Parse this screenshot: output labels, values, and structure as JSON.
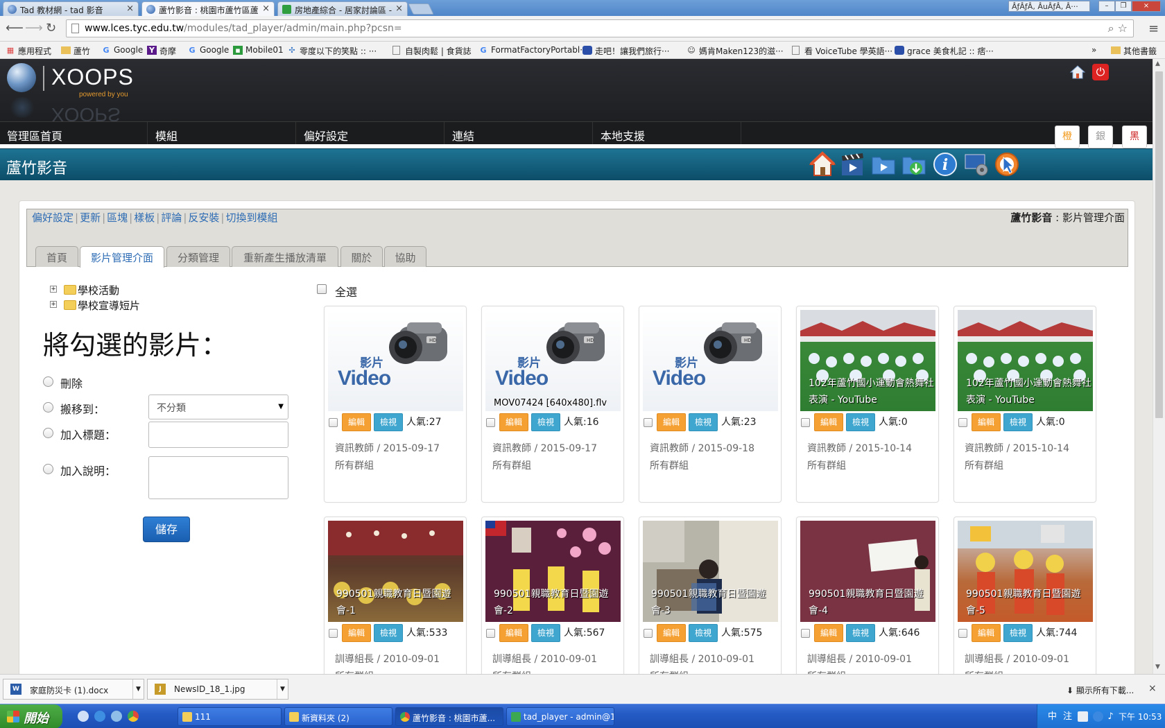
{
  "browser": {
    "tabs": [
      {
        "title": "Tad 教材網 - tad 影音"
      },
      {
        "title": "蘆竹影音 : 桃園市蘆竹區蘆"
      },
      {
        "title": "房地產綜合 - 居家討論區 -"
      }
    ],
    "tab_close": "×",
    "window_user": "ÂƒÂƒÂ, ÂuÂƒÂ, Â···",
    "window_buttons": {
      "minimize": "–",
      "restore": "❐",
      "close": "×"
    },
    "url_host": "www.lces.tyc.edu.tw",
    "url_path": "/modules/tad_player/admin/main.php?pcsn=",
    "bookmarks": [
      "應用程式",
      "蘆竹",
      "Google",
      "奇摩",
      "Google",
      "Mobile01",
      "零度以下的笑點 :: ···",
      "自製肉鬆 | 食貨誌",
      "FormatFactoryPortabl···",
      "走吧！讓我們旅行···",
      "媽肯Maken123的滋···",
      "看 VoiceTube 學英語···",
      "grace 美食札記 :: 痞···"
    ],
    "bookmarks_more": "»",
    "other_bookmarks": "其他書籤"
  },
  "site": {
    "logo": "XOOPS",
    "logo_sub": "powered by you",
    "menu": [
      "管理區首頁",
      "模組",
      "偏好設定",
      "連結",
      "本地支援"
    ],
    "theme_buttons": [
      "橙",
      "銀",
      "黑"
    ]
  },
  "module": {
    "title": "蘆竹影音"
  },
  "admin": {
    "links": [
      "偏好設定",
      "更新",
      "區塊",
      "樣板",
      "評論",
      "反安裝",
      "切換到模組"
    ],
    "module_name": "蘆竹影音",
    "page_name": " : 影片管理介面",
    "tabs": [
      "首頁",
      "影片管理介面",
      "分類管理",
      "重新產生播放清單",
      "關於",
      "協助"
    ],
    "active_tab": "影片管理介面"
  },
  "tree": {
    "items": [
      "學校活動",
      "學校宣導短片"
    ],
    "expander": "+"
  },
  "batch": {
    "heading": "將勾選的影片：",
    "delete_label": "刪除",
    "move_label": "搬移到：",
    "move_value": "不分類",
    "add_title_label": "加入標題：",
    "add_desc_label": "加入說明：",
    "save_label": "儲存"
  },
  "select_all": "全選",
  "card_labels": {
    "edit": "編輯",
    "view": "檢視",
    "popularity_prefix": "人氣:"
  },
  "placeholder": {
    "zh": "影片",
    "en": "Video"
  },
  "videos": [
    {
      "thumb": "placeholder",
      "caption": "",
      "views": "27",
      "author_date": "資訊教師 / 2015-09-17",
      "group": "所有群組"
    },
    {
      "thumb": "placeholder",
      "caption": "MOV07424 [640x480].flv",
      "views": "16",
      "author_date": "資訊教師 / 2015-09-17",
      "group": "所有群組"
    },
    {
      "thumb": "placeholder",
      "caption": "",
      "views": "23",
      "author_date": "資訊教師 / 2015-09-18",
      "group": "所有群組"
    },
    {
      "thumb": "photo-dance",
      "title": "102年蘆竹國小運動會熱舞社表演 - YouTube",
      "views": "0",
      "author_date": "資訊教師 / 2015-10-14",
      "group": "所有群組"
    },
    {
      "thumb": "photo-dance",
      "title": "102年蘆竹國小運動會熱舞社表演 - YouTube",
      "views": "0",
      "author_date": "資訊教師 / 2015-10-14",
      "group": "所有群組"
    },
    {
      "thumb": "photo-hall",
      "title": "990501親職教育日暨園遊會-1",
      "views": "533",
      "author_date": "訓導組長 / 2010-09-01",
      "group": "所有群組"
    },
    {
      "thumb": "photo-stage",
      "title": "990501親職教育日暨園遊會-2",
      "views": "567",
      "author_date": "訓導組長 / 2010-09-01",
      "group": "所有群組"
    },
    {
      "thumb": "photo-violin",
      "title": "990501親職教育日暨園遊會-3",
      "views": "575",
      "author_date": "訓導組長 / 2010-09-01",
      "group": "所有群組"
    },
    {
      "thumb": "photo-sign",
      "title": "990501親職教育日暨園遊會-4",
      "views": "646",
      "author_date": "訓導組長 / 2010-09-01",
      "group": "所有群組"
    },
    {
      "thumb": "photo-kids",
      "title": "990501親職教育日暨園遊會-5",
      "views": "744",
      "author_date": "訓導組長 / 2010-09-01",
      "group": "所有群組"
    }
  ],
  "downloads": {
    "items": [
      "家庭防災卡 (1).docx",
      "NewsID_18_1.jpg"
    ],
    "show_all": "顯示所有下載...",
    "close": "×"
  },
  "taskbar": {
    "start": "開始",
    "buttons": [
      "111",
      "新資料夾 (2)",
      "蘆竹影音 : 桃園市蘆...",
      "tad_player - admin@1..."
    ],
    "clock": "下午 10:53"
  }
}
